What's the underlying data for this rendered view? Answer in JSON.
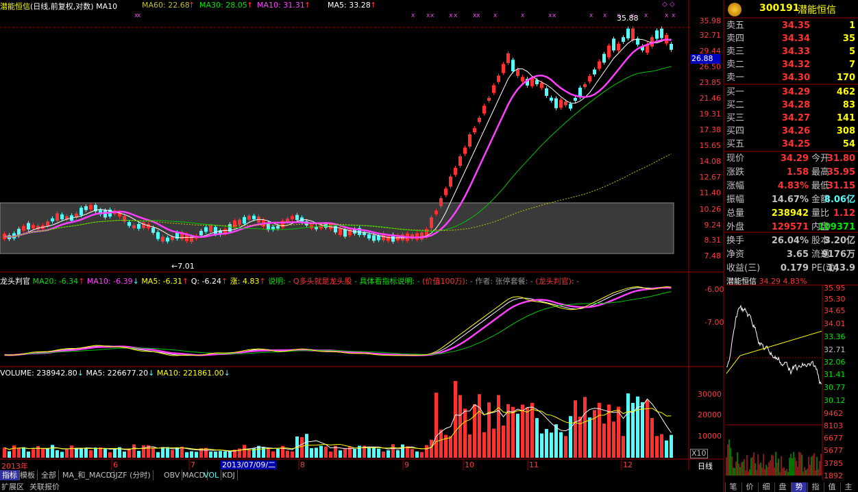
{
  "main_header": {
    "title": "潜能恒信",
    "subtitle": "(日线,前复权,对数)",
    "ma10_tag": "MA10",
    "ma60": "MA60: 22.68",
    "ma30": "MA30: 28.05",
    "ma10": "MA10: 31.31",
    "ma5": "MA5: 33.28",
    "arrow_up": "↑"
  },
  "price_axis": [
    "35.98",
    "32.71",
    "29.44",
    "26.50",
    "23.85",
    "21.46",
    "19.31",
    "17.38",
    "15.65",
    "14.08",
    "12.67",
    "11.40",
    "10.26",
    "9.24",
    "8.31",
    "7.48"
  ],
  "current_price_tag": "26.88",
  "annotations": {
    "high": "35.88",
    "low": "7.01",
    "low_arrow": "←"
  },
  "indicator_header": {
    "name": "龙头判官",
    "ma20": "MA20: -6.34",
    "ma10": "MA10: -6.39",
    "ma5": "MA5: -6.31",
    "q": "Q: -6.24",
    "zhang": "涨: 4.83",
    "desc1": "说明: -",
    "desc2": "Q多头就是龙头股",
    "desc3": "- 具体看指标说明: -",
    "desc4": "(价值100万)",
    "desc5": ": - 作者: 张停套餐: -",
    "desc6": "(龙头判官)",
    "desc7": ": -",
    "up": "↑",
    "down": "↓"
  },
  "indicator_axis": [
    "-6.00",
    "-7.00"
  ],
  "volume_header": {
    "volume": "VOLUME: 238942.80",
    "ma5": "MA5: 226677.20",
    "ma10": "MA10: 221861.00",
    "down": "↓"
  },
  "volume_axis": [
    "30000",
    "20000",
    "10000"
  ],
  "volume_unit": "X10",
  "date_axis": {
    "labels": [
      "2013年",
      "6",
      "7",
      "8",
      "9",
      "10",
      "11",
      "12"
    ],
    "cursor_date": "2013/07/09/二",
    "period": "日线"
  },
  "tabs": [
    "指标",
    "模板",
    "全部",
    "MA_和_MACD",
    "GJZF (分时)",
    "OBV",
    "MACD",
    "VOL",
    "KDJ"
  ],
  "bottom_tabs": [
    "扩展区",
    "关联报价"
  ],
  "quote": {
    "code": "300191",
    "name": "潜能恒信",
    "sell": [
      {
        "label": "卖五",
        "price": "34.35",
        "vol": "1"
      },
      {
        "label": "卖四",
        "price": "34.34",
        "vol": "35"
      },
      {
        "label": "卖三",
        "price": "34.33",
        "vol": "5"
      },
      {
        "label": "卖二",
        "price": "34.32",
        "vol": "7"
      },
      {
        "label": "卖一",
        "price": "34.30",
        "vol": "170"
      }
    ],
    "buy": [
      {
        "label": "买一",
        "price": "34.29",
        "vol": "462"
      },
      {
        "label": "买二",
        "price": "34.28",
        "vol": "83"
      },
      {
        "label": "买三",
        "price": "34.27",
        "vol": "141"
      },
      {
        "label": "买四",
        "price": "34.26",
        "vol": "308"
      },
      {
        "label": "买五",
        "price": "34.25",
        "vol": "54"
      }
    ],
    "stats": [
      {
        "l1": "现价",
        "v1": "34.29",
        "l2": "今开",
        "v2": "31.80"
      },
      {
        "l1": "涨跌",
        "v1": "1.58",
        "l2": "最高",
        "v2": "35.95"
      },
      {
        "l1": "涨幅",
        "v1": "4.83%",
        "l2": "最低",
        "v2": "31.15"
      },
      {
        "l1": "振幅",
        "v1": "14.67%",
        "l2": "金额",
        "v2": "8.06亿"
      },
      {
        "l1": "总量",
        "v1": "238942",
        "l2": "量比",
        "v2": "1.12"
      },
      {
        "l1": "外盘",
        "v1": "129571",
        "l2": "内盘",
        "v2": "109371"
      },
      {
        "l1": "换手",
        "v1": "26.04%",
        "l2": "股本",
        "v2": "3.20亿"
      },
      {
        "l1": "净资",
        "v1": "3.65",
        "l2": "流通",
        "v2": "9176万"
      },
      {
        "l1": "收益(三)",
        "v1": "0.179",
        "l2": "PE(动)",
        "v2": "143.9"
      }
    ]
  },
  "mini_chart": {
    "title": "潜能恒信",
    "price": "34.29",
    "pct": "4.83%",
    "price_axis": [
      "35.95",
      "35.30",
      "34.65",
      "34.01",
      "33.36",
      "32.71",
      "32.06",
      "31.41",
      "30.77",
      "30.12"
    ],
    "vol_axis": [
      "9462",
      "8103",
      "6677",
      "5677",
      "3785",
      "1892"
    ]
  },
  "right_tabs": [
    "笔",
    "价",
    "细",
    "盘",
    "势",
    "指",
    "值",
    "主"
  ],
  "colors": {
    "up": "#ff3232",
    "down": "#54fcfc",
    "ma5": "#ffffff",
    "ma10": "#ff40ff",
    "ma30": "#00c800",
    "ma60": "#c8c800"
  }
}
